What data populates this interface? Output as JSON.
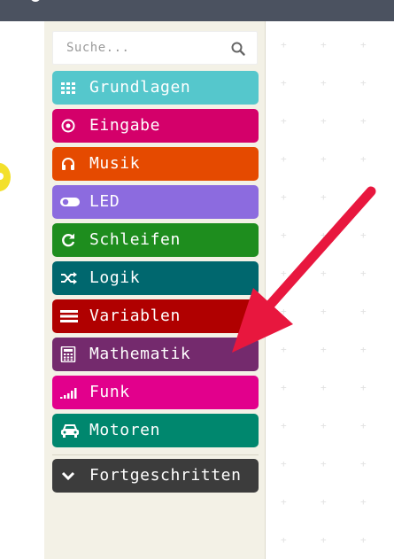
{
  "search": {
    "placeholder": "Suche...",
    "icon": "search-icon"
  },
  "categories": [
    {
      "label": "Grundlagen",
      "color": "#55c7cc",
      "icon": "grid-icon"
    },
    {
      "label": "Eingabe",
      "color": "#d4006a",
      "icon": "target-icon"
    },
    {
      "label": "Musik",
      "color": "#e54a00",
      "icon": "headphones-icon"
    },
    {
      "label": "LED",
      "color": "#8c6bdf",
      "icon": "toggle-icon"
    },
    {
      "label": "Schleifen",
      "color": "#1e8d1e",
      "icon": "refresh-icon"
    },
    {
      "label": "Logik",
      "color": "#00676e",
      "icon": "shuffle-icon"
    },
    {
      "label": "Variablen",
      "color": "#b00000",
      "icon": "list-icon"
    },
    {
      "label": "Mathematik",
      "color": "#742a6d",
      "icon": "calculator-icon"
    },
    {
      "label": "Funk",
      "color": "#e2008c",
      "icon": "signal-icon"
    },
    {
      "label": "Motoren",
      "color": "#00876e",
      "icon": "car-icon"
    }
  ],
  "advanced": {
    "label": "Fortgeschritten",
    "color": "#3c3c3c",
    "icon": "chevron-down-icon"
  },
  "annotation": {
    "color": "#e8173e"
  }
}
